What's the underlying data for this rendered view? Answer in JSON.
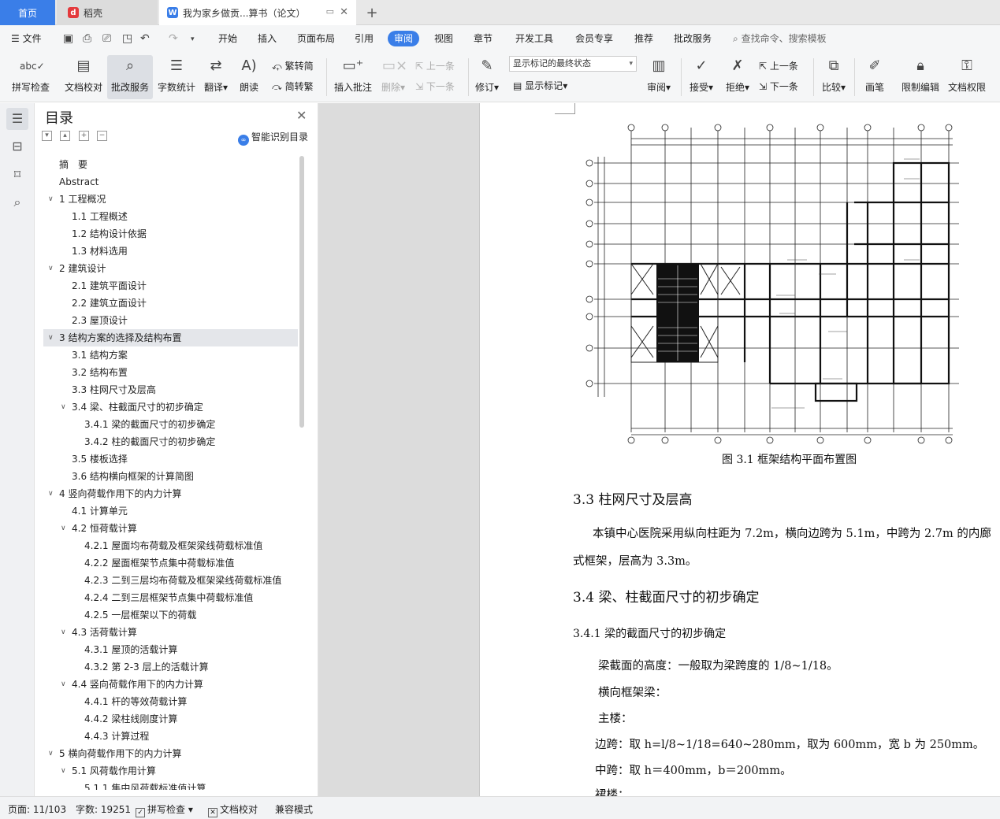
{
  "tabs": {
    "home": "首页",
    "daoke": "稻壳",
    "doc": "我为家乡做贡...算书（论文）"
  },
  "menu": {
    "file": "文件",
    "items": [
      "开始",
      "插入",
      "页面布局",
      "引用",
      "审阅",
      "视图",
      "章节",
      "开发工具",
      "会员专享",
      "推荐",
      "批改服务"
    ],
    "active": "审阅",
    "search": "查找命令、搜索模板"
  },
  "ribbon": {
    "spellcheck": "拼写检查",
    "doc_check": "文档校对",
    "review_service": "批改服务",
    "word_count": "字数统计",
    "translate": "翻译",
    "read_aloud": "朗读",
    "trad_to_simp": "繁转简",
    "simp_to_trad": "简转繁",
    "insert_comment": "插入批注",
    "delete": "删除",
    "prev_comment": "上一条",
    "next_comment": "下一条",
    "revise": "修订",
    "markup_state": "显示标记的最终状态",
    "show_markup": "显示标记",
    "review": "审阅",
    "accept": "接受",
    "reject": "拒绝",
    "prev_change": "上一条",
    "next_change": "下一条",
    "compare": "比较",
    "pen": "画笔",
    "restrict_edit": "限制编辑",
    "doc_permission": "文档权限"
  },
  "toc": {
    "title": "目录",
    "smart": "智能识别目录",
    "items": [
      {
        "level": 0,
        "text": "摘　要",
        "caret": ""
      },
      {
        "level": 0,
        "text": "Abstract",
        "caret": ""
      },
      {
        "level": 0,
        "text": "1  工程概况",
        "caret": "down"
      },
      {
        "level": 1,
        "text": "1.1 工程概述",
        "caret": ""
      },
      {
        "level": 1,
        "text": "1.2 结构设计依据",
        "caret": ""
      },
      {
        "level": 1,
        "text": "1.3 材料选用",
        "caret": ""
      },
      {
        "level": 0,
        "text": "2  建筑设计",
        "caret": "down"
      },
      {
        "level": 1,
        "text": "2.1  建筑平面设计",
        "caret": ""
      },
      {
        "level": 1,
        "text": "2.2  建筑立面设计",
        "caret": ""
      },
      {
        "level": 1,
        "text": "2.3  屋顶设计",
        "caret": ""
      },
      {
        "level": 0,
        "text": "3  结构方案的选择及结构布置",
        "caret": "down",
        "selected": true
      },
      {
        "level": 1,
        "text": "3.1 结构方案",
        "caret": ""
      },
      {
        "level": 1,
        "text": "3.2 结构布置",
        "caret": ""
      },
      {
        "level": 1,
        "text": "3.3 柱网尺寸及层高",
        "caret": ""
      },
      {
        "level": 1,
        "text": "3.4 梁、柱截面尺寸的初步确定",
        "caret": "down"
      },
      {
        "level": 2,
        "text": "3.4.1 梁的截面尺寸的初步确定",
        "caret": ""
      },
      {
        "level": 2,
        "text": "3.4.2 柱的截面尺寸的初步确定",
        "caret": ""
      },
      {
        "level": 1,
        "text": "3.5 楼板选择",
        "caret": ""
      },
      {
        "level": 1,
        "text": "3.6 结构横向框架的计算简图",
        "caret": ""
      },
      {
        "level": 0,
        "text": "4  竖向荷载作用下的内力计算",
        "caret": "down"
      },
      {
        "level": 1,
        "text": "4.1 计算单元",
        "caret": ""
      },
      {
        "level": 1,
        "text": "4.2 恒荷载计算",
        "caret": "down"
      },
      {
        "level": 2,
        "text": "4.2.1 屋面均布荷载及框架梁线荷载标准值",
        "caret": ""
      },
      {
        "level": 2,
        "text": "4.2.2 屋面框架节点集中荷载标准值",
        "caret": ""
      },
      {
        "level": 2,
        "text": "4.2.3  二到三层均布荷载及框架梁线荷载标准值",
        "caret": ""
      },
      {
        "level": 2,
        "text": "4.2.4 二到三层框架节点集中荷载标准值",
        "caret": ""
      },
      {
        "level": 2,
        "text": "4.2.5 一层框架以下的荷载",
        "caret": ""
      },
      {
        "level": 1,
        "text": "4.3 活荷载计算",
        "caret": "down"
      },
      {
        "level": 2,
        "text": "4.3.1 屋顶的活载计算",
        "caret": ""
      },
      {
        "level": 2,
        "text": "4.3.2 第 2-3 层上的活载计算",
        "caret": ""
      },
      {
        "level": 1,
        "text": "4.4 竖向荷载作用下的内力计算",
        "caret": "down"
      },
      {
        "level": 2,
        "text": "4.4.1 杆的等效荷载计算",
        "caret": ""
      },
      {
        "level": 2,
        "text": "4.4.2 梁柱线刚度计算",
        "caret": ""
      },
      {
        "level": 2,
        "text": "4.4.3 计算过程",
        "caret": ""
      },
      {
        "level": 0,
        "text": "5  横向荷载作用下的内力计算",
        "caret": "down"
      },
      {
        "level": 1,
        "text": "5.1 风荷载作用计算",
        "caret": "down"
      },
      {
        "level": 2,
        "text": "5.1.1 集中风荷载标准值计算",
        "caret": ""
      }
    ]
  },
  "document": {
    "figure_caption": "图 3.1 框架结构平面布置图",
    "heading_33": "3.3 柱网尺寸及层高",
    "para_33_line1": "本镇中心医院采用纵向柱距为 7.2m，横向边跨为 5.1m，中跨为 2.7m 的内廊",
    "para_33_line2": "式框架，层高为 3.3m。",
    "heading_34": "3.4 梁、柱截面尺寸的初步确定",
    "heading_341": "3.4.1 梁的截面尺寸的初步确定",
    "line_beam_height": "梁截面的高度：一般取为梁跨度的 1/8~1/18。",
    "line_transverse": "横向框架梁：",
    "line_main": "主楼：",
    "line_edge": "边跨：取 h=l/8~1/18=640~280mm，取为 600mm，宽 b 为 250mm。",
    "line_middle": "中跨：取 h＝400mm，b＝200mm。",
    "line_annex": "裙楼："
  },
  "status": {
    "page": "页面: 11/103",
    "words": "字数: 19251",
    "spellcheck": "拼写检查",
    "doc_check": "文档校对",
    "compat": "兼容模式"
  },
  "colors": {
    "accent": "#3a7ee8",
    "daoke_red": "#e4393c"
  }
}
